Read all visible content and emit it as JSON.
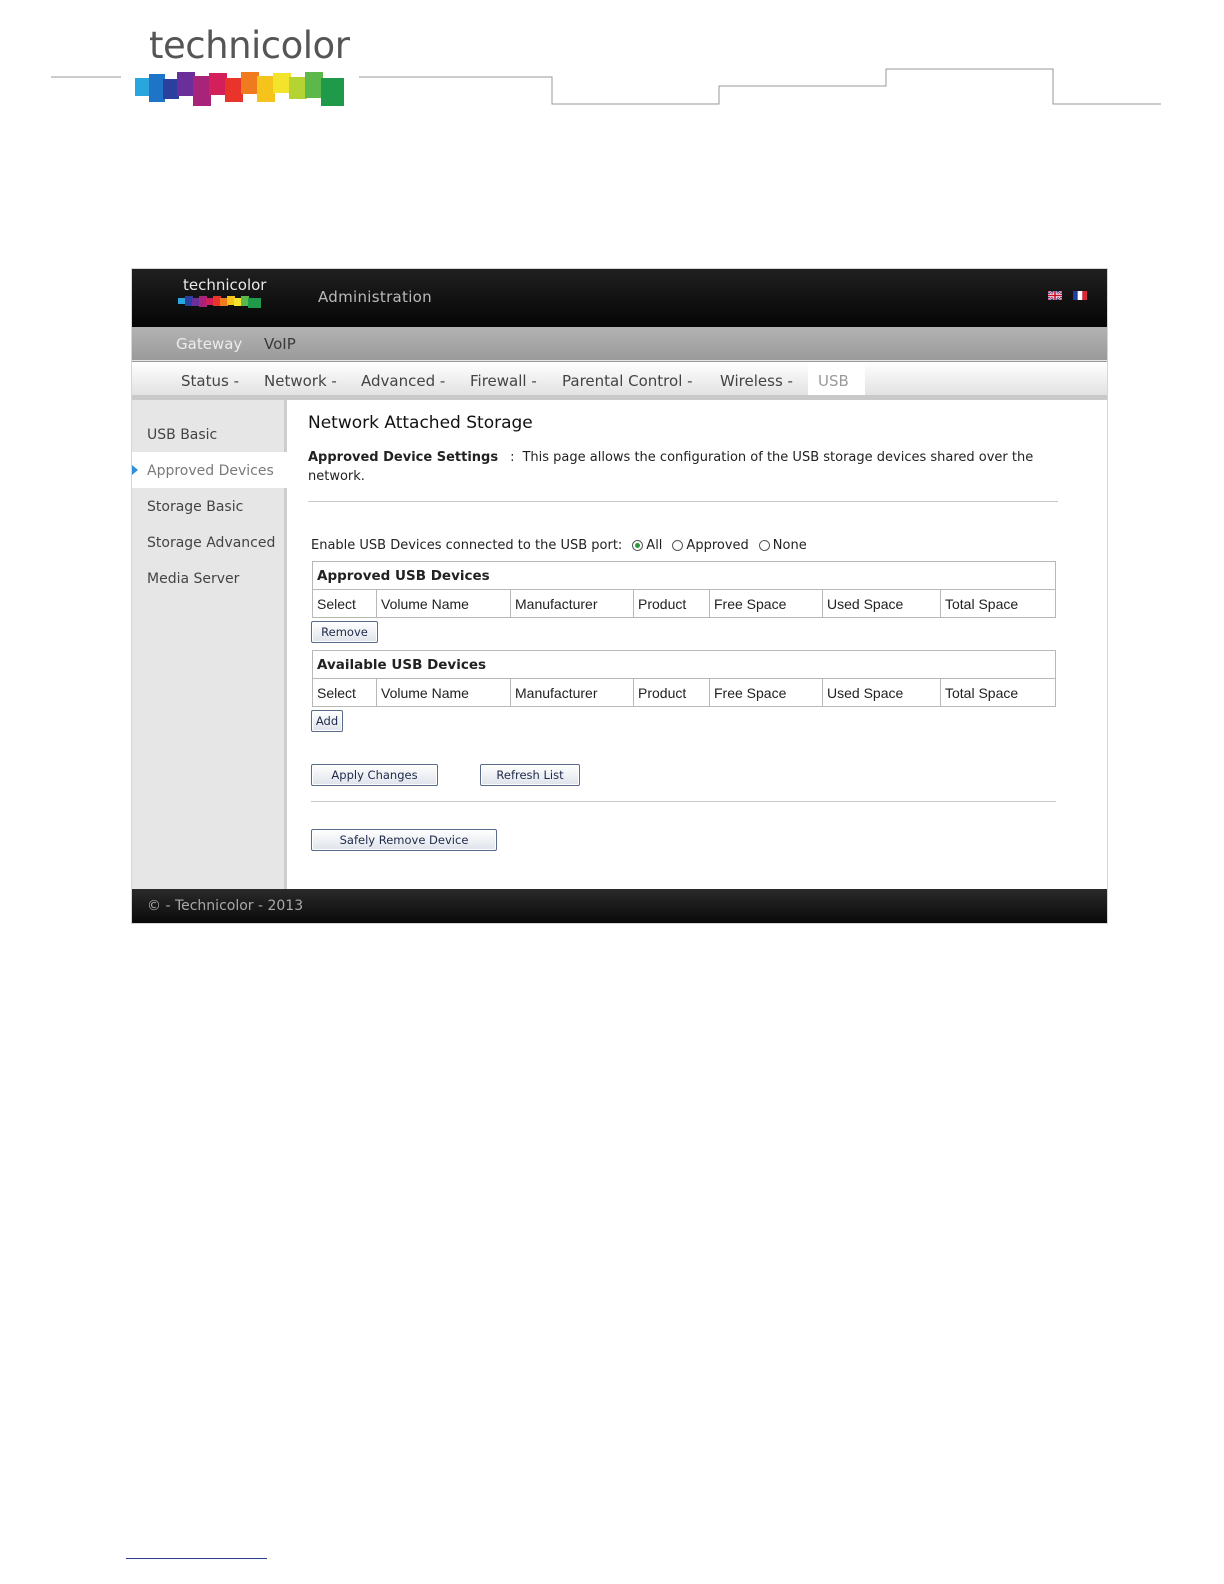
{
  "doc": {
    "logo_text": "technicolor"
  },
  "app": {
    "logo_text": "technicolor",
    "title": "Administration",
    "languages": [
      "en-flag-icon",
      "fr-flag-icon"
    ]
  },
  "nav_primary": [
    {
      "label": "Gateway",
      "active": true
    },
    {
      "label": "VoIP",
      "active": false
    }
  ],
  "nav_secondary": [
    {
      "label": "Status -"
    },
    {
      "label": "Network -"
    },
    {
      "label": "Advanced -"
    },
    {
      "label": "Firewall -"
    },
    {
      "label": "Parental Control -"
    },
    {
      "label": "Wireless -"
    },
    {
      "label": "USB",
      "active": true
    }
  ],
  "sidebar": {
    "items": [
      {
        "label": "USB Basic"
      },
      {
        "label": "Approved Devices",
        "active": true
      },
      {
        "label": "Storage Basic"
      },
      {
        "label": "Storage Advanced"
      },
      {
        "label": "Media Server"
      }
    ]
  },
  "main": {
    "title": "Network Attached Storage",
    "desc_label": "Approved Device Settings",
    "desc_colon": ":",
    "desc_text": "This page allows the configuration of the USB storage devices shared over the network.",
    "enable_label": "Enable USB Devices connected to the USB port:",
    "radio_options": [
      {
        "label": "All",
        "checked": true
      },
      {
        "label": "Approved",
        "checked": false
      },
      {
        "label": "None",
        "checked": false
      }
    ],
    "approved_table": {
      "caption": "Approved USB Devices",
      "columns": [
        "Select",
        "Volume Name",
        "Manufacturer",
        "Product",
        "Free Space",
        "Used Space",
        "Total Space"
      ]
    },
    "available_table": {
      "caption": "Available USB Devices",
      "columns": [
        "Select",
        "Volume Name",
        "Manufacturer",
        "Product",
        "Free Space",
        "Used Space",
        "Total Space"
      ]
    },
    "buttons": {
      "remove": "Remove",
      "add": "Add",
      "apply": "Apply Changes",
      "refresh": "Refresh List",
      "safe_remove": "Safely Remove Device"
    }
  },
  "footer": {
    "text": "© - Technicolor - 2013"
  },
  "colors": {
    "accent_blue": "#2f8fd8",
    "topbar": "#101010",
    "sidebar": "#e6e6e6"
  }
}
